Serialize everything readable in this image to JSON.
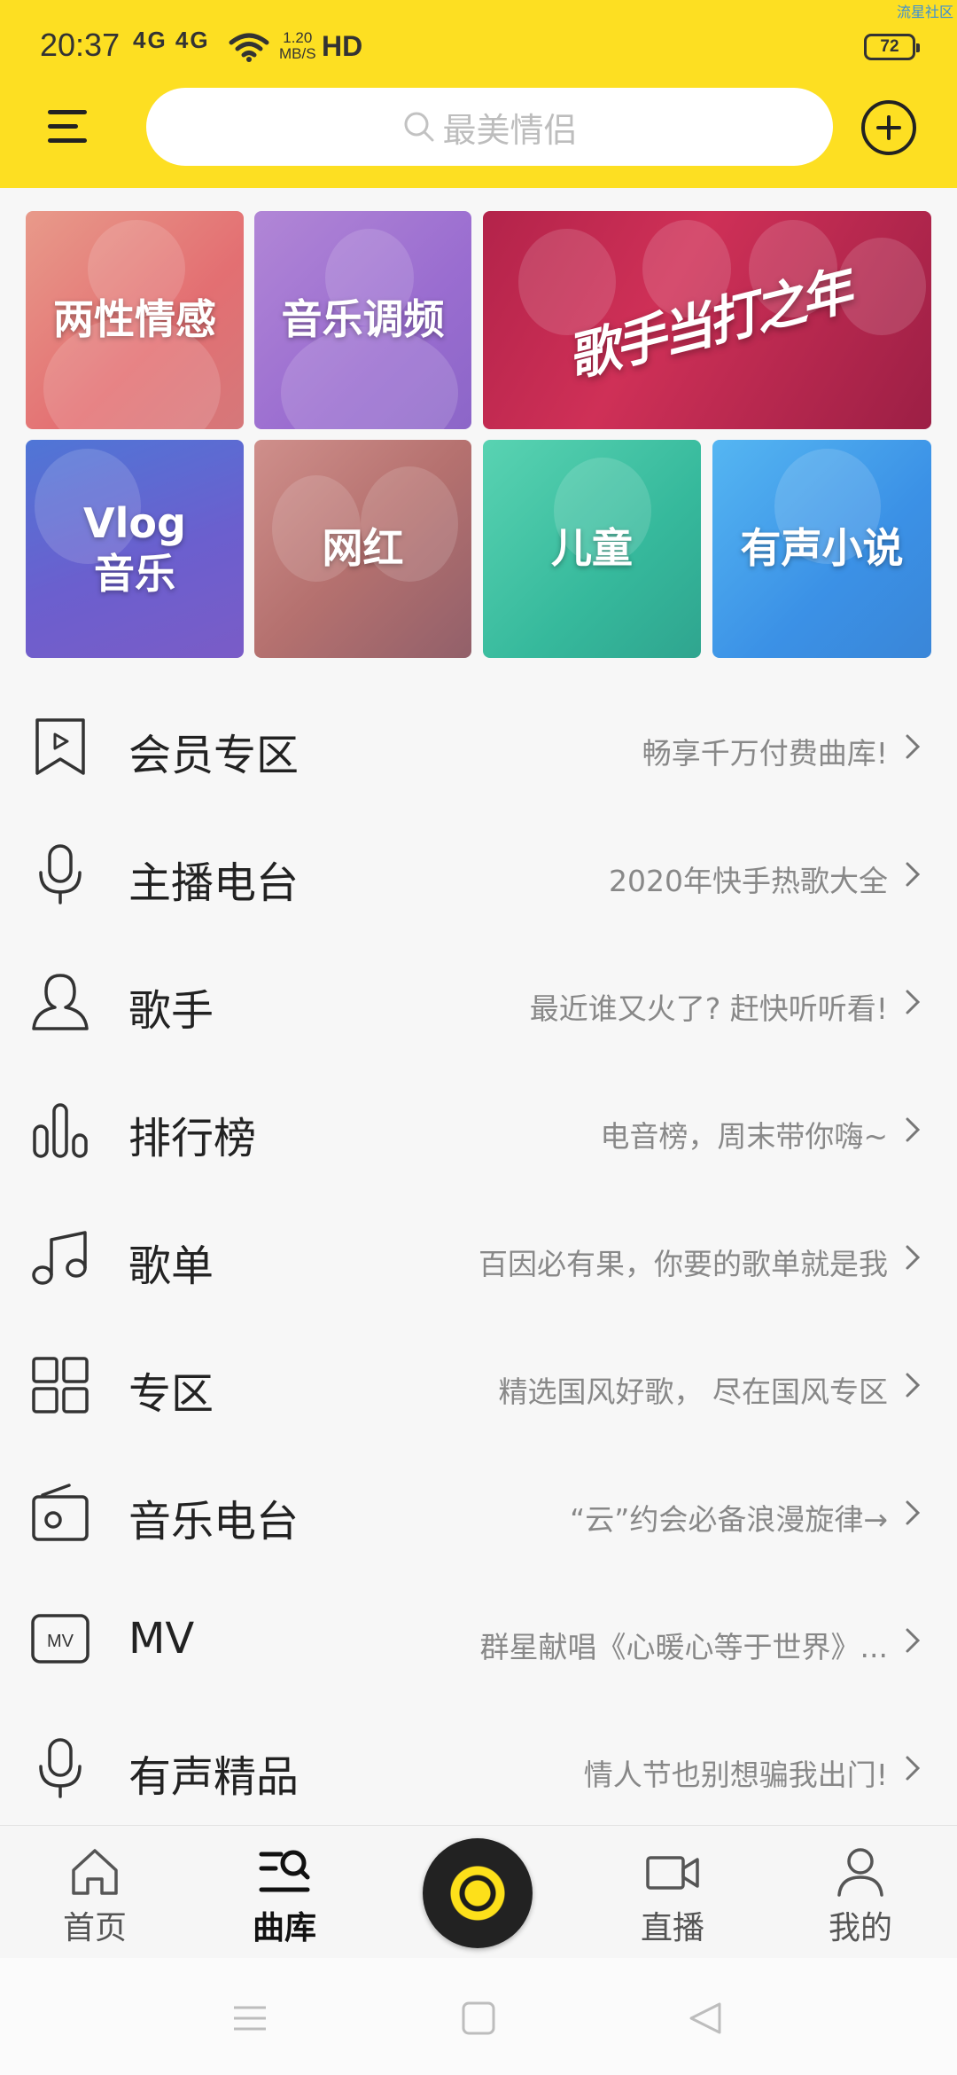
{
  "status_bar": {
    "time": "20:37",
    "network": "4G 4G",
    "speed_value": "1.20",
    "speed_unit": "MB/S",
    "hd_label": "HD",
    "battery": "72",
    "watermark": "流星社区"
  },
  "header": {
    "search_placeholder": "最美情侣",
    "accent_color": "#fddf22"
  },
  "tiles": [
    {
      "label": "两性情感"
    },
    {
      "label": "音乐调频"
    },
    {
      "label": "歌手当打之年"
    },
    {
      "label": "Vlog\n音乐"
    },
    {
      "label": "网红"
    },
    {
      "label": "儿童"
    },
    {
      "label": "有声小说"
    }
  ],
  "list": [
    {
      "icon": "bookmark-play-icon",
      "title": "会员专区",
      "desc": "畅享千万付费曲库!"
    },
    {
      "icon": "microphone-icon",
      "title": "主播电台",
      "desc": "2020年快手热歌大全"
    },
    {
      "icon": "singer-person-icon",
      "title": "歌手",
      "desc": "最近谁又火了? 赶快听听看!"
    },
    {
      "icon": "bar-chart-icon",
      "title": "排行榜",
      "desc": "电音榜，周末带你嗨~"
    },
    {
      "icon": "music-note-icon",
      "title": "歌单",
      "desc": "百因必有果，你要的歌单就是我"
    },
    {
      "icon": "grid-icon",
      "title": "专区",
      "desc": "精选国风好歌， 尽在国风专区"
    },
    {
      "icon": "radio-icon",
      "title": "音乐电台",
      "desc": "“云”约会必备浪漫旋律→"
    },
    {
      "icon": "mv-icon",
      "title": "MV",
      "desc": "群星献唱《心暖心等于世界》..."
    },
    {
      "icon": "microphone-icon",
      "title": "有声精品",
      "desc": "情人节也别想骗我出门!"
    }
  ],
  "bottom_nav": {
    "home": "首页",
    "library": "曲库",
    "live": "直播",
    "mine": "我的",
    "active": "曲库"
  }
}
